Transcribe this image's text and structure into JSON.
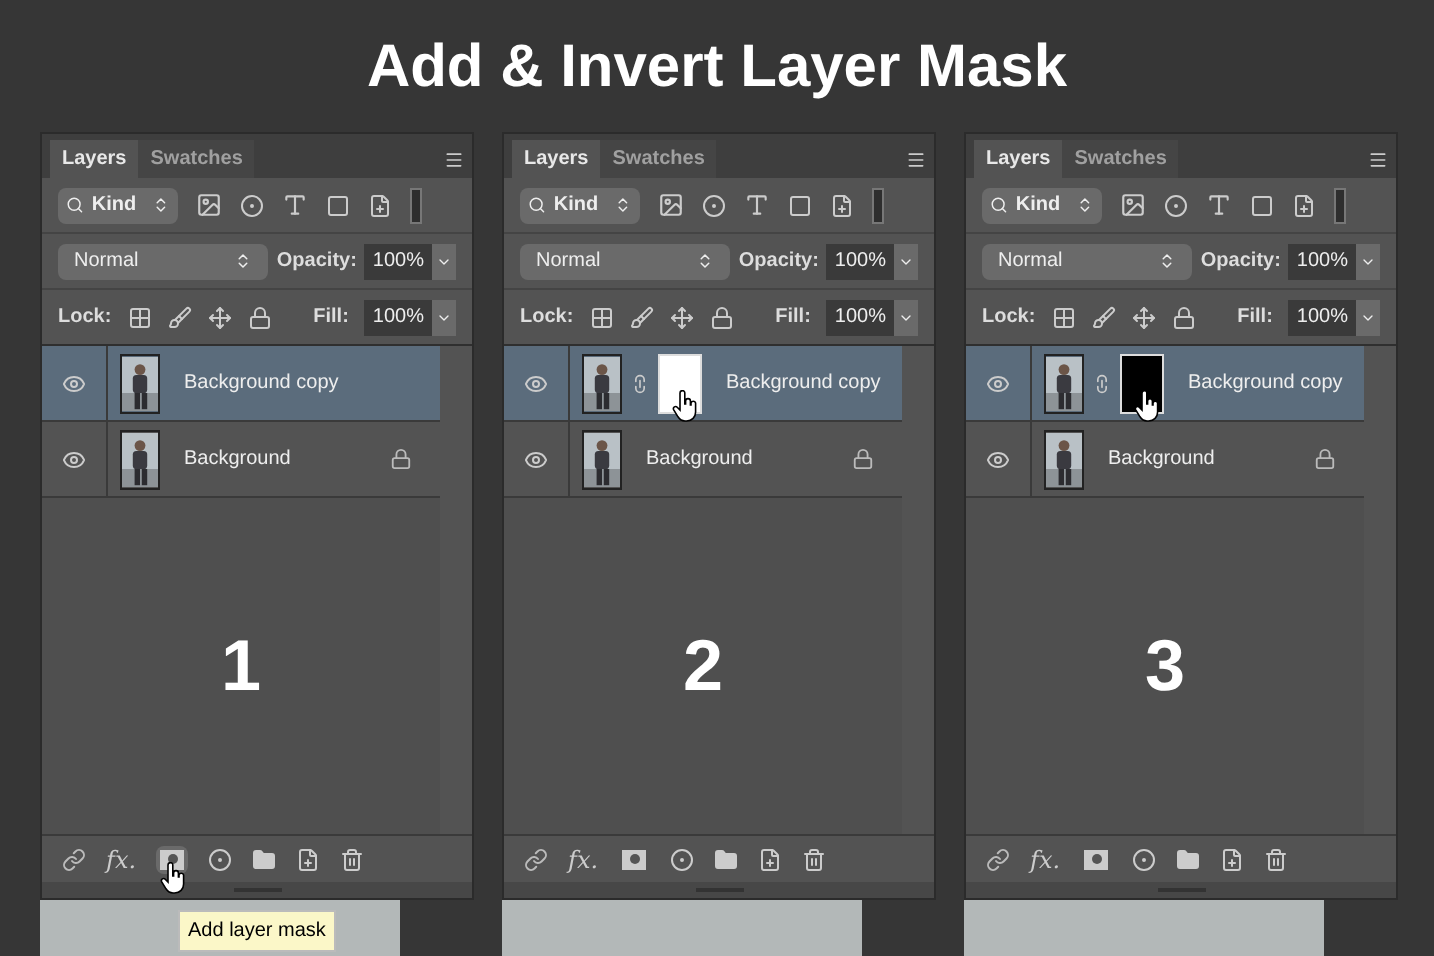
{
  "title": "Add & Invert Layer Mask",
  "panels": [
    {
      "tabs": [
        {
          "label": "Layers",
          "selected": true
        },
        {
          "label": "Swatches",
          "selected": false
        }
      ],
      "filter": "Kind",
      "blend_mode": "Normal",
      "opacity_label": "Opacity:",
      "opacity": "100%",
      "lock_label": "Lock:",
      "fill_label": "Fill:",
      "fill": "100%",
      "layers": [
        {
          "name": "Background copy",
          "selected": true,
          "masked": false,
          "locked": false
        },
        {
          "name": "Background",
          "selected": false,
          "masked": false,
          "locked": true
        }
      ],
      "step": "1",
      "fx_label": "fx.",
      "tooltip": "Add layer mask"
    },
    {
      "tabs": [
        {
          "label": "Layers",
          "selected": true
        },
        {
          "label": "Swatches",
          "selected": false
        }
      ],
      "filter": "Kind",
      "blend_mode": "Normal",
      "opacity_label": "Opacity:",
      "opacity": "100%",
      "lock_label": "Lock:",
      "fill_label": "Fill:",
      "fill": "100%",
      "layers": [
        {
          "name": "Background copy",
          "selected": true,
          "masked": true,
          "mask_inverted": false,
          "locked": false
        },
        {
          "name": "Background",
          "selected": false,
          "masked": false,
          "locked": true
        }
      ],
      "step": "2",
      "fx_label": "fx."
    },
    {
      "tabs": [
        {
          "label": "Layers",
          "selected": true
        },
        {
          "label": "Swatches",
          "selected": false
        }
      ],
      "filter": "Kind",
      "blend_mode": "Normal",
      "opacity_label": "Opacity:",
      "opacity": "100%",
      "lock_label": "Lock:",
      "fill_label": "Fill:",
      "fill": "100%",
      "layers": [
        {
          "name": "Background copy",
          "selected": true,
          "masked": true,
          "mask_inverted": true,
          "locked": false
        },
        {
          "name": "Background",
          "selected": false,
          "masked": false,
          "locked": true
        }
      ],
      "step": "3",
      "fx_label": "fx."
    }
  ]
}
